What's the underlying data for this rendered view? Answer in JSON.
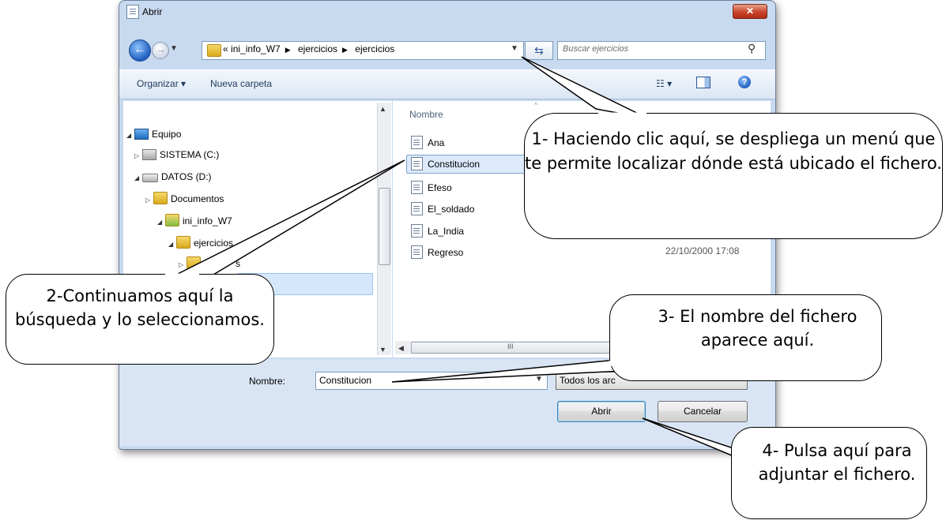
{
  "window": {
    "title": "Abrir",
    "close_glyph": "✕"
  },
  "nav": {
    "back_glyph": "←",
    "forward_glyph": "→",
    "breadcrumb": {
      "overflow": "«",
      "items": [
        "ini_info_W7",
        "ejercicios",
        "ejercicios"
      ]
    },
    "search_placeholder": "Buscar ejercicios"
  },
  "toolbar": {
    "organize_label": "Organizar ▾",
    "new_folder_label": "Nueva carpeta",
    "views_glyph": "☷ ▾",
    "help_glyph": "?"
  },
  "tree": {
    "items": [
      {
        "label": "Equipo",
        "icon": "computer-icon"
      },
      {
        "label": "SISTEMA (C:)",
        "icon": "drive-c-icon"
      },
      {
        "label": "DATOS (D:)",
        "icon": "drive-d-icon"
      },
      {
        "label": "Documentos",
        "icon": "folder-icon"
      },
      {
        "label": "ini_info_W7",
        "icon": "folder-image-icon"
      },
      {
        "label": "ejercicios",
        "icon": "folder-icon"
      },
      {
        "label": "s",
        "icon": "folder-icon"
      }
    ]
  },
  "files": {
    "column_name": "Nombre",
    "items": [
      "Ana",
      "Constitucion",
      "Efeso",
      "El_soldado",
      "La_India",
      "Regreso"
    ],
    "visible_date": "22/10/2000 17:08",
    "hscroll_glyph": "III"
  },
  "bottom": {
    "name_label": "Nombre:",
    "name_value": "Constitucion",
    "type_value": "Todos los arc",
    "open_button": "Abrir",
    "cancel_button": "Cancelar"
  },
  "callouts": {
    "c1": "1- Haciendo clic aquí, se despliega un menú que te permite localizar dónde está ubicado el fichero.",
    "c2": "2-Continuamos aquí la búsqueda y lo seleccionamos.",
    "c3": "3- El nombre del fichero aparece aquí.",
    "c4": "4- Pulsa aquí para adjuntar el fichero."
  }
}
